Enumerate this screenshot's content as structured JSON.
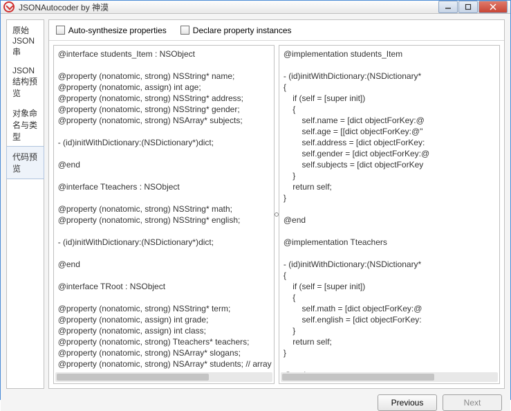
{
  "window": {
    "title": "JSONAutocoder by 神漠"
  },
  "sidebar": {
    "items": [
      {
        "label": "原始JSON串",
        "active": false
      },
      {
        "label": "JSON结构预览",
        "active": false
      },
      {
        "label": "对象命名与类型",
        "active": false
      },
      {
        "label": "代码预览",
        "active": true
      }
    ]
  },
  "toolbar": {
    "auto_synth_label": "Auto-synthesize properties",
    "declare_inst_label": "Declare property instances"
  },
  "panes": {
    "left": "@interface students_Item : NSObject\n\n@property (nonatomic, strong) NSString* name;\n@property (nonatomic, assign) int age;\n@property (nonatomic, strong) NSString* address;\n@property (nonatomic, strong) NSString* gender;\n@property (nonatomic, strong) NSArray* subjects;\n\n- (id)initWithDictionary:(NSDictionary*)dict;\n\n@end\n\n@interface Tteachers : NSObject\n\n@property (nonatomic, strong) NSString* math;\n@property (nonatomic, strong) NSString* english;\n\n- (id)initWithDictionary:(NSDictionary*)dict;\n\n@end\n\n@interface TRoot : NSObject\n\n@property (nonatomic, strong) NSString* term;\n@property (nonatomic, assign) int grade;\n@property (nonatomic, assign) int class;\n@property (nonatomic, strong) Tteachers* teachers;\n@property (nonatomic, strong) NSArray* slogans;\n@property (nonatomic, strong) NSArray* students; // array of students_Item",
    "right": "@implementation students_Item\n\n- (id)initWithDictionary:(NSDictionary*\n{\n    if (self = [super init])\n    {\n        self.name = [dict objectForKey:@\n        self.age = [[dict objectForKey:@\"\n        self.address = [dict objectForKey:\n        self.gender = [dict objectForKey:@\n        self.subjects = [dict objectForKey\n    }\n    return self;\n}\n\n@end\n\n@implementation Tteachers\n\n- (id)initWithDictionary:(NSDictionary*\n{\n    if (self = [super init])\n    {\n        self.math = [dict objectForKey:@\n        self.english = [dict objectForKey:\n    }\n    return self;\n}\n\n@end"
  },
  "footer": {
    "prev_label": "Previous",
    "next_label": "Next"
  }
}
